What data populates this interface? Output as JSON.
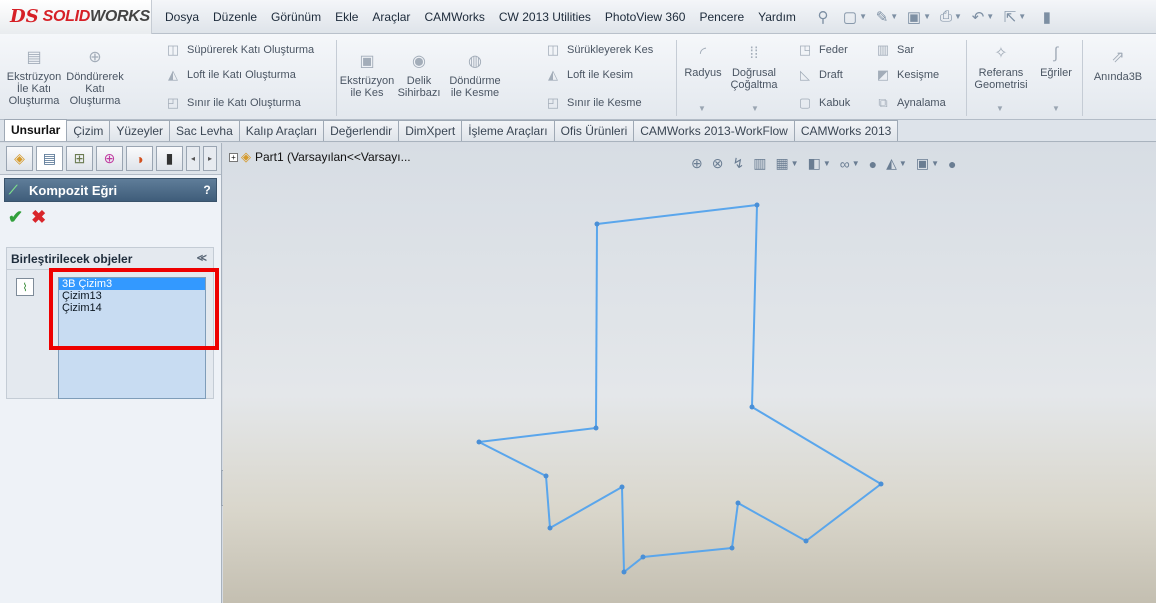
{
  "app": {
    "brand_prefix": "DS",
    "brand_main": "SOLID",
    "brand_suffix": "WORKS"
  },
  "menu": [
    "Dosya",
    "Düzenle",
    "Görünüm",
    "Ekle",
    "Araçlar",
    "CAMWorks",
    "CW 2013 Utilities",
    "PhotoView 360",
    "Pencere",
    "Yardım"
  ],
  "toolbar": {
    "extrude_boss": "Ekstrüzyon İle Katı Oluşturma",
    "extrude_boss_l1": "Ekstrüzyon",
    "extrude_boss_l2": "İle Katı",
    "extrude_boss_l3": "Oluşturma",
    "revolve_boss_l1": "Döndürerek",
    "revolve_boss_l2": "Katı",
    "revolve_boss_l3": "Oluşturma",
    "swept_boss": "Süpürerek Katı Oluşturma",
    "loft_boss": "Loft ile Katı Oluşturma",
    "boundary_boss": "Sınır ile Katı Oluşturma",
    "extrude_cut_l1": "Ekstrüzyon",
    "extrude_cut_l2": "ile Kes",
    "hole_wizard_l1": "Delik",
    "hole_wizard_l2": "Sihirbazı",
    "revolve_cut_l1": "Döndürme",
    "revolve_cut_l2": "ile Kesme",
    "swept_cut": "Sürükleyerek Kes",
    "loft_cut": "Loft ile Kesim",
    "boundary_cut": "Sınır ile Kesme",
    "fillet": "Radyus",
    "linear_pattern_l1": "Doğrusal",
    "linear_pattern_l2": "Çoğaltma",
    "rib": "Feder",
    "draft": "Draft",
    "shell": "Kabuk",
    "wrap": "Sar",
    "intersect": "Kesişme",
    "mirror": "Aynalama",
    "ref_geom_l1": "Referans",
    "ref_geom_l2": "Geometrisi",
    "curves": "Eğriler",
    "instant3d": "Anında3B"
  },
  "tabs": [
    "Unsurlar",
    "Çizim",
    "Yüzeyler",
    "Sac Levha",
    "Kalıp Araçları",
    "Değerlendir",
    "DimXpert",
    "İşleme Araçları",
    "Ofis Ürünleri",
    "CAMWorks 2013-WorkFlow",
    "CAMWorks 2013"
  ],
  "active_tab": "Unsurlar",
  "property_manager": {
    "title": "Kompozit Eğri",
    "help": "?",
    "group_title": "Birleştirilecek objeler",
    "entities": [
      "3B Çizim3",
      "Çizim13",
      "Çizim14"
    ],
    "selected_entity": "3B Çizim3"
  },
  "tree": {
    "root_label": "Part1  (Varsayılan<<Varsayı..."
  },
  "colors": {
    "accent_red": "#d62027",
    "sketch_blue": "#5aa6ec",
    "highlight": "#ee0000",
    "selection": "#3399ff"
  },
  "icons": [
    "search-icon",
    "zoom-area-icon",
    "previous-view-icon",
    "section-view-icon",
    "view-orientation-icon",
    "display-style-icon",
    "hide-show-icon",
    "edit-appearance-icon",
    "apply-scene-icon",
    "view-settings-icon"
  ]
}
